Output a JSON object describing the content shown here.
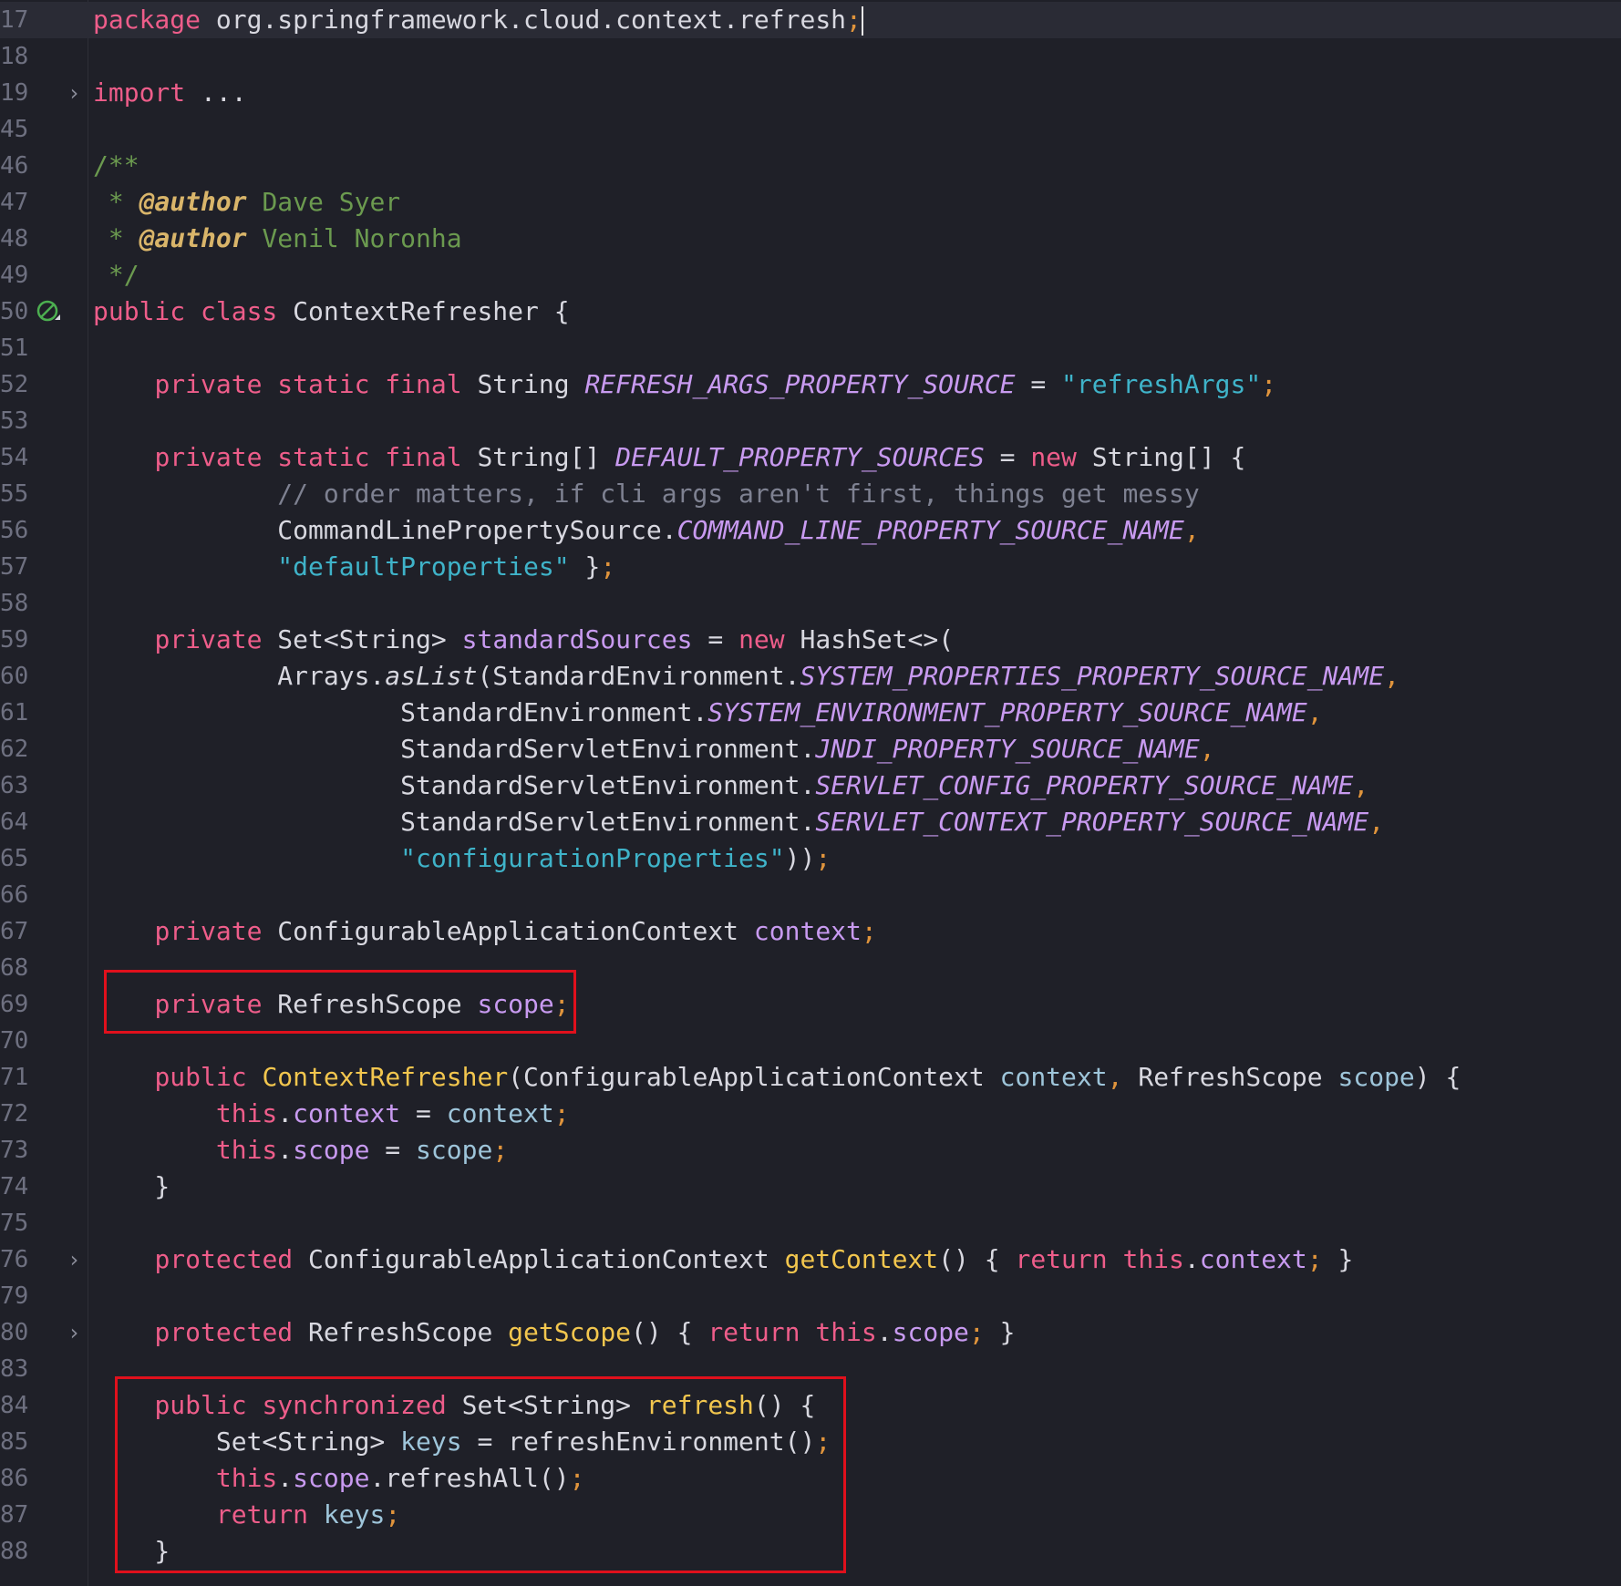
{
  "editor": {
    "highlight_color": "#e0101c",
    "lines": [
      {
        "n": "17",
        "tokens": [
          [
            "kw",
            "package"
          ],
          [
            "cls",
            " org.springframework.cloud.context.refresh"
          ],
          [
            "punc",
            ";"
          ]
        ],
        "current": true,
        "cursor": true
      },
      {
        "n": "18",
        "tokens": []
      },
      {
        "n": "19",
        "fold": "›",
        "tokens": [
          [
            "kw",
            "import"
          ],
          [
            "cls",
            " ..."
          ]
        ]
      },
      {
        "n": "45",
        "tokens": []
      },
      {
        "n": "46",
        "tokens": [
          [
            "cmt",
            "/**"
          ]
        ]
      },
      {
        "n": "47",
        "tokens": [
          [
            "cmt",
            " * "
          ],
          [
            "tag",
            "@author"
          ],
          [
            "cmt",
            " Dave Syer"
          ]
        ]
      },
      {
        "n": "48",
        "tokens": [
          [
            "cmt",
            " * "
          ],
          [
            "tag",
            "@author"
          ],
          [
            "cmt",
            " Venil Noronha"
          ]
        ]
      },
      {
        "n": "49",
        "tokens": [
          [
            "cmt",
            " */"
          ]
        ]
      },
      {
        "n": "50",
        "icon": "bean-icon",
        "tokens": [
          [
            "kw",
            "public class"
          ],
          [
            "cls",
            " ContextRefresher {"
          ]
        ]
      },
      {
        "n": "51",
        "tokens": []
      },
      {
        "n": "52",
        "tokens": [
          [
            "cls",
            "    "
          ],
          [
            "kw",
            "private static final"
          ],
          [
            "cls",
            " String "
          ],
          [
            "const",
            "REFRESH_ARGS_PROPERTY_SOURCE"
          ],
          [
            "cls",
            " = "
          ],
          [
            "str",
            "\"refreshArgs\""
          ],
          [
            "punc",
            ";"
          ]
        ]
      },
      {
        "n": "53",
        "tokens": []
      },
      {
        "n": "54",
        "tokens": [
          [
            "cls",
            "    "
          ],
          [
            "kw",
            "private static final"
          ],
          [
            "cls",
            " String[] "
          ],
          [
            "const",
            "DEFAULT_PROPERTY_SOURCES"
          ],
          [
            "cls",
            " = "
          ],
          [
            "kw",
            "new"
          ],
          [
            "cls",
            " String[] {"
          ]
        ]
      },
      {
        "n": "55",
        "tokens": [
          [
            "cls",
            "            "
          ],
          [
            "cmt-grey",
            "// order matters, if cli args aren't first, things get messy"
          ]
        ]
      },
      {
        "n": "56",
        "tokens": [
          [
            "cls",
            "            CommandLinePropertySource."
          ],
          [
            "const",
            "COMMAND_LINE_PROPERTY_SOURCE_NAME"
          ],
          [
            "punc",
            ","
          ]
        ]
      },
      {
        "n": "57",
        "tokens": [
          [
            "cls",
            "            "
          ],
          [
            "str",
            "\"defaultProperties\""
          ],
          [
            "cls",
            " }"
          ],
          [
            "punc",
            ";"
          ]
        ]
      },
      {
        "n": "58",
        "tokens": []
      },
      {
        "n": "59",
        "tokens": [
          [
            "cls",
            "    "
          ],
          [
            "kw",
            "private"
          ],
          [
            "cls",
            " Set<String> "
          ],
          [
            "fld",
            "standardSources"
          ],
          [
            "cls",
            " = "
          ],
          [
            "kw",
            "new"
          ],
          [
            "cls",
            " HashSet<>("
          ]
        ]
      },
      {
        "n": "60",
        "tokens": [
          [
            "cls",
            "            Arrays."
          ],
          [
            "static-fn",
            "asList"
          ],
          [
            "cls",
            "(StandardEnvironment."
          ],
          [
            "const",
            "SYSTEM_PROPERTIES_PROPERTY_SOURCE_NAME"
          ],
          [
            "punc",
            ","
          ]
        ]
      },
      {
        "n": "61",
        "tokens": [
          [
            "cls",
            "                    StandardEnvironment."
          ],
          [
            "const",
            "SYSTEM_ENVIRONMENT_PROPERTY_SOURCE_NAME"
          ],
          [
            "punc",
            ","
          ]
        ]
      },
      {
        "n": "62",
        "tokens": [
          [
            "cls",
            "                    StandardServletEnvironment."
          ],
          [
            "const",
            "JNDI_PROPERTY_SOURCE_NAME"
          ],
          [
            "punc",
            ","
          ]
        ]
      },
      {
        "n": "63",
        "tokens": [
          [
            "cls",
            "                    StandardServletEnvironment."
          ],
          [
            "const",
            "SERVLET_CONFIG_PROPERTY_SOURCE_NAME"
          ],
          [
            "punc",
            ","
          ]
        ]
      },
      {
        "n": "64",
        "tokens": [
          [
            "cls",
            "                    StandardServletEnvironment."
          ],
          [
            "const",
            "SERVLET_CONTEXT_PROPERTY_SOURCE_NAME"
          ],
          [
            "punc",
            ","
          ]
        ]
      },
      {
        "n": "65",
        "tokens": [
          [
            "cls",
            "                    "
          ],
          [
            "str",
            "\"configurationProperties\""
          ],
          [
            "cls",
            "))"
          ],
          [
            "punc",
            ";"
          ]
        ]
      },
      {
        "n": "66",
        "tokens": []
      },
      {
        "n": "67",
        "tokens": [
          [
            "cls",
            "    "
          ],
          [
            "kw",
            "private"
          ],
          [
            "cls",
            " ConfigurableApplicationContext "
          ],
          [
            "fld",
            "context"
          ],
          [
            "punc",
            ";"
          ]
        ]
      },
      {
        "n": "68",
        "tokens": []
      },
      {
        "n": "69",
        "tokens": [
          [
            "cls",
            "    "
          ],
          [
            "kw",
            "private"
          ],
          [
            "cls",
            " RefreshScope "
          ],
          [
            "fld",
            "scope"
          ],
          [
            "punc",
            ";"
          ]
        ]
      },
      {
        "n": "70",
        "tokens": []
      },
      {
        "n": "71",
        "tokens": [
          [
            "cls",
            "    "
          ],
          [
            "kw",
            "public"
          ],
          [
            "cls",
            " "
          ],
          [
            "fn",
            "ContextRefresher"
          ],
          [
            "cls",
            "(ConfigurableApplicationContext "
          ],
          [
            "par",
            "context"
          ],
          [
            "punc",
            ","
          ],
          [
            "cls",
            " RefreshScope "
          ],
          [
            "par",
            "scope"
          ],
          [
            "cls",
            ") {"
          ]
        ]
      },
      {
        "n": "72",
        "tokens": [
          [
            "cls",
            "        "
          ],
          [
            "kw",
            "this"
          ],
          [
            "cls",
            "."
          ],
          [
            "fld",
            "context"
          ],
          [
            "cls",
            " = "
          ],
          [
            "par",
            "context"
          ],
          [
            "punc",
            ";"
          ]
        ]
      },
      {
        "n": "73",
        "tokens": [
          [
            "cls",
            "        "
          ],
          [
            "kw",
            "this"
          ],
          [
            "cls",
            "."
          ],
          [
            "fld",
            "scope"
          ],
          [
            "cls",
            " = "
          ],
          [
            "par",
            "scope"
          ],
          [
            "punc",
            ";"
          ]
        ]
      },
      {
        "n": "74",
        "tokens": [
          [
            "cls",
            "    }"
          ]
        ]
      },
      {
        "n": "75",
        "tokens": []
      },
      {
        "n": "76",
        "fold": "›",
        "tokens": [
          [
            "cls",
            "    "
          ],
          [
            "kw",
            "protected"
          ],
          [
            "cls",
            " ConfigurableApplicationContext "
          ],
          [
            "fn",
            "getContext"
          ],
          [
            "cls",
            "() { "
          ],
          [
            "kw",
            "return this"
          ],
          [
            "cls",
            "."
          ],
          [
            "fld",
            "context"
          ],
          [
            "punc",
            ";"
          ],
          [
            "cls",
            " }"
          ]
        ]
      },
      {
        "n": "79",
        "tokens": []
      },
      {
        "n": "80",
        "fold": "›",
        "tokens": [
          [
            "cls",
            "    "
          ],
          [
            "kw",
            "protected"
          ],
          [
            "cls",
            " RefreshScope "
          ],
          [
            "fn",
            "getScope"
          ],
          [
            "cls",
            "() { "
          ],
          [
            "kw",
            "return this"
          ],
          [
            "cls",
            "."
          ],
          [
            "fld",
            "scope"
          ],
          [
            "punc",
            ";"
          ],
          [
            "cls",
            " }"
          ]
        ]
      },
      {
        "n": "83",
        "tokens": []
      },
      {
        "n": "84",
        "tokens": [
          [
            "cls",
            "    "
          ],
          [
            "kw",
            "public synchronized"
          ],
          [
            "cls",
            " Set<String> "
          ],
          [
            "fn",
            "refresh"
          ],
          [
            "cls",
            "() {"
          ]
        ]
      },
      {
        "n": "85",
        "tokens": [
          [
            "cls",
            "        Set<String> "
          ],
          [
            "par",
            "keys"
          ],
          [
            "cls",
            " = refreshEnvironment()"
          ],
          [
            "punc",
            ";"
          ]
        ]
      },
      {
        "n": "86",
        "tokens": [
          [
            "cls",
            "        "
          ],
          [
            "kw",
            "this"
          ],
          [
            "cls",
            "."
          ],
          [
            "fld",
            "scope"
          ],
          [
            "cls",
            ".refreshAll()"
          ],
          [
            "punc",
            ";"
          ]
        ]
      },
      {
        "n": "87",
        "tokens": [
          [
            "cls",
            "        "
          ],
          [
            "kw",
            "return"
          ],
          [
            "cls",
            " "
          ],
          [
            "par",
            "keys"
          ],
          [
            "punc",
            ";"
          ]
        ]
      },
      {
        "n": "88",
        "tokens": [
          [
            "cls",
            "    }"
          ]
        ]
      }
    ]
  }
}
